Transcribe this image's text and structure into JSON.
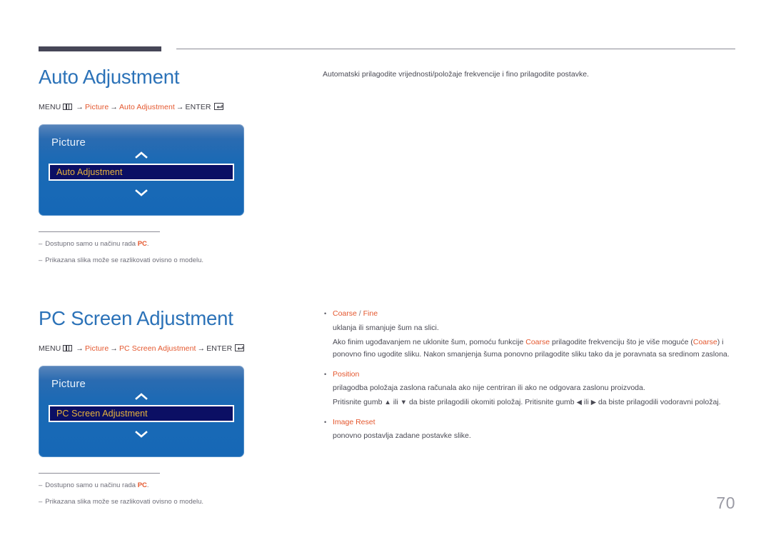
{
  "header": {
    "rule_thick_color": "#464657",
    "rule_thin_color": "#8d8d96"
  },
  "colors": {
    "heading_blue": "#2b72b8",
    "accent_orange": "#e4572e",
    "osd_highlight_bg": "#0b0f64",
    "osd_highlight_text": "#e8b33c",
    "body_gray": "#4a4a54",
    "note_gray": "#6f6f7a",
    "page_number_gray": "#9a9aa4"
  },
  "sections": [
    {
      "heading": "Auto Adjustment",
      "menupath": {
        "menu_label": "MENU",
        "menu_icon": "menu-grid-icon",
        "arrow": "→",
        "step1": "Picture",
        "step2": "Auto Adjustment",
        "enter_label": "ENTER",
        "enter_icon": "enter-return-icon"
      },
      "osd": {
        "title": "Picture",
        "chevron_up": "chevron-up-icon",
        "chevron_down": "chevron-down-icon",
        "selected_item": "Auto Adjustment"
      },
      "notes": [
        {
          "dash": "–",
          "pre": "Dostupno samo u načinu rada ",
          "hl": "PC",
          "post": "."
        },
        {
          "dash": "–",
          "pre": "Prikazana slika može se razlikovati ovisno o modelu.",
          "hl": "",
          "post": ""
        }
      ]
    },
    {
      "heading": "PC Screen Adjustment",
      "menupath": {
        "menu_label": "MENU",
        "menu_icon": "menu-grid-icon",
        "arrow": "→",
        "step1": "Picture",
        "step2": "PC Screen Adjustment",
        "enter_label": "ENTER",
        "enter_icon": "enter-return-icon"
      },
      "osd": {
        "title": "Picture",
        "chevron_up": "chevron-up-icon",
        "chevron_down": "chevron-down-icon",
        "selected_item": "PC Screen Adjustment"
      },
      "notes": [
        {
          "dash": "–",
          "pre": "Dostupno samo u načinu rada ",
          "hl": "PC",
          "post": "."
        },
        {
          "dash": "–",
          "pre": "Prikazana slika može se razlikovati ovisno o modelu.",
          "hl": "",
          "post": ""
        }
      ]
    }
  ],
  "right": {
    "intro": "Automatski prilagodite vrijednosti/položaje frekvencije i fino prilagodite postavke.",
    "bullets": [
      {
        "dot": "•",
        "title_main": "Coarse",
        "title_sep": " / ",
        "title_alt": "Fine",
        "paragraphs": [
          {
            "p1": "uklanja ili smanjuje šum na slici."
          },
          {
            "a": "Ako finim ugođavanjem ne uklonite šum, pomoću funkcije ",
            "hl1": "Coarse",
            "b": " prilagodite frekvenciju što je više moguće (",
            "hl2": "Coarse",
            "c": ") i ponovno fino ugodite sliku. Nakon smanjenja šuma ponovno prilagodite sliku tako da je poravnata sa sredinom zaslona."
          }
        ]
      },
      {
        "dot": "•",
        "title_main": "Position",
        "title_sep": "",
        "title_alt": "",
        "paragraphs": [
          {
            "p1": "prilagodba položaja zaslona računala ako nije centriran ili ako ne odgovara zaslonu proizvoda."
          },
          {
            "a": "Pritisnite gumb ",
            "g1": "▲",
            "b": " ili ",
            "g2": "▼",
            "c": " da biste prilagodili okomiti položaj. Pritisnite gumb ",
            "g3": "◀",
            "d": " ili ",
            "g4": "▶",
            "e": " da biste prilagodili vodoravni položaj."
          }
        ]
      },
      {
        "dot": "•",
        "title_main": "Image Reset",
        "title_sep": "",
        "title_alt": "",
        "paragraphs": [
          {
            "p1": "ponovno postavlja zadane postavke slike."
          }
        ]
      }
    ]
  },
  "page_number": "70"
}
